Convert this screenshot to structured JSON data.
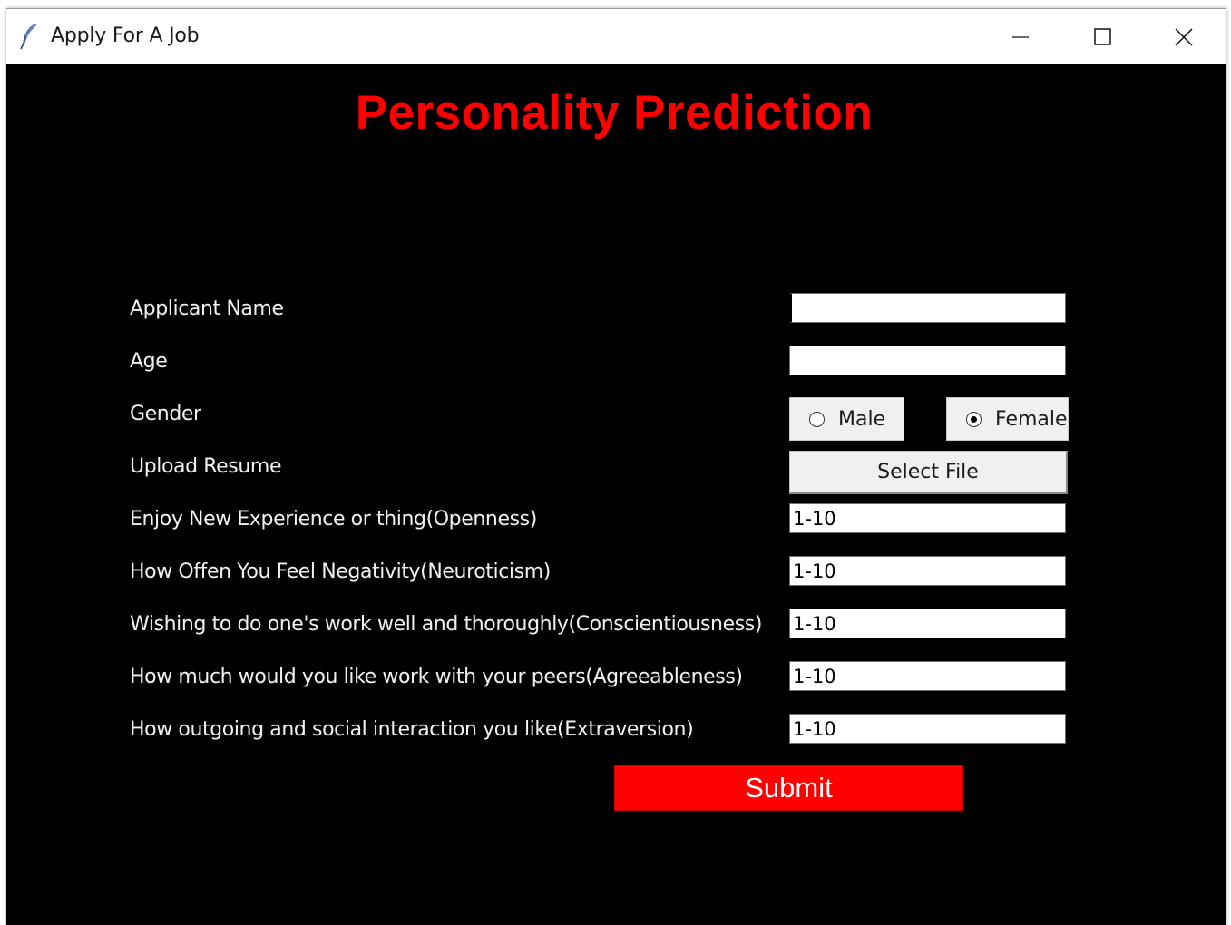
{
  "window": {
    "title": "Apply For A Job",
    "icon": "feather-icon"
  },
  "header": {
    "title": "Personality Prediction"
  },
  "form": {
    "name_label": "Applicant Name",
    "name_value": "",
    "age_label": "Age",
    "age_value": "",
    "gender_label": "Gender",
    "gender_options": [
      "Male",
      "Female"
    ],
    "gender_selected": "Female",
    "resume_label": "Upload Resume",
    "resume_button": "Select File",
    "openness_label": "Enjoy New Experience or thing(Openness)",
    "openness_value": "1-10",
    "neuroticism_label": "How Offen You Feel Negativity(Neuroticism)",
    "neuroticism_value": "1-10",
    "conscientiousness_label": "Wishing to do one's work well and thoroughly(Conscientiousness)",
    "conscientiousness_value": "1-10",
    "agreeableness_label": "How much would you like work with your peers(Agreeableness)",
    "agreeableness_value": "1-10",
    "extraversion_label": "How outgoing and social interaction you like(Extraversion)",
    "extraversion_value": "1-10",
    "submit_label": "Submit"
  },
  "colors": {
    "accent": "#ff0000",
    "background": "#000000",
    "label_text": "#f2f2f2"
  }
}
